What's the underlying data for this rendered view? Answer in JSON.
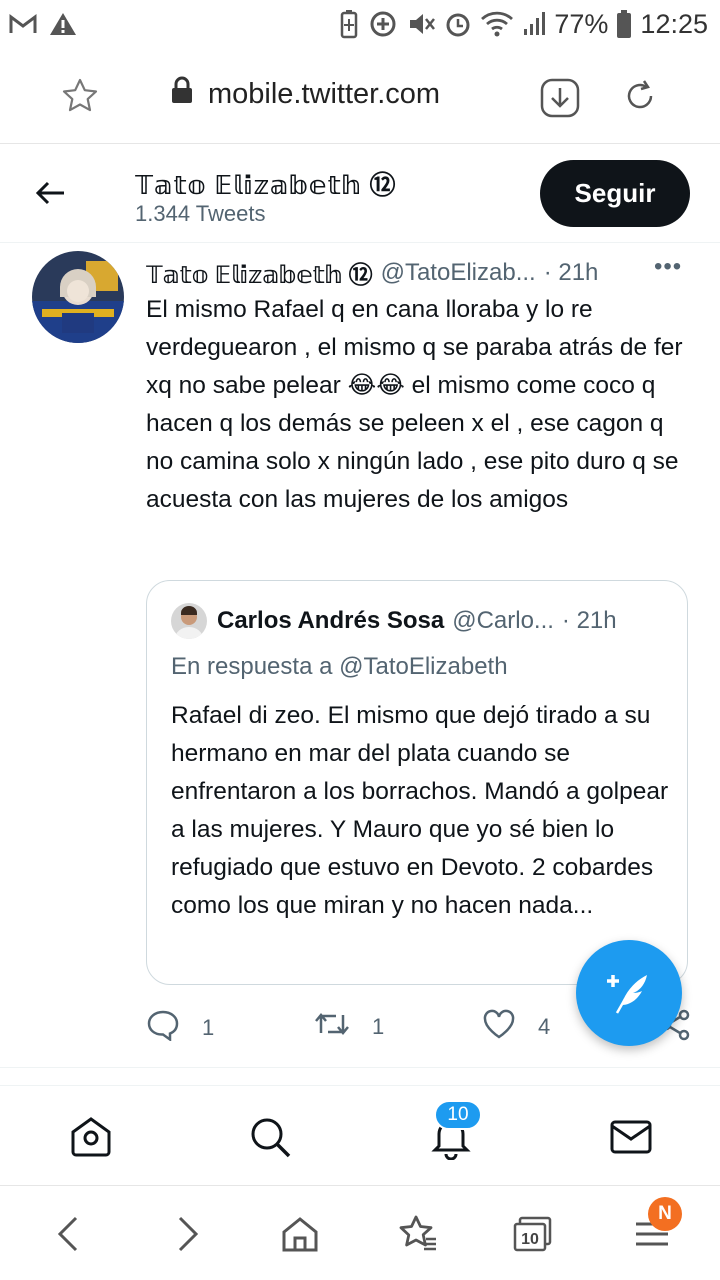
{
  "status_bar": {
    "battery": "77%",
    "time": "12:25"
  },
  "browser": {
    "url": "mobile.twitter.com",
    "tabs_count": "10",
    "menu_badge": "N"
  },
  "profile": {
    "name": "𝕋𝕒𝕥𝕠 𝔼𝕝𝕚𝕫𝕒𝕓𝕖𝕥𝕙 ⑫",
    "tweet_count": "1.344 Tweets",
    "follow_label": "Seguir"
  },
  "tweet": {
    "author_name": "𝕋𝕒𝕥𝕠 𝔼𝕝𝕚𝕫𝕒𝕓𝕖𝕥𝕙 ⑫",
    "handle": "@TatoElizab...",
    "time": "· 21h",
    "more": "•••",
    "text": "El mismo Rafael q en cana lloraba y lo re verdeguearon , el mismo q se paraba atrás de fer xq no sabe pelear 😂😂 el mismo come coco q hacen q los demás se peleen x el , ese cagon q no camina solo x ningún lado , ese pito duro q se acuesta con las mujeres de los amigos",
    "replies": "1",
    "retweets": "1",
    "likes": "4"
  },
  "quote": {
    "author_name": "Carlos Andrés Sosa",
    "handle": "@Carlo...",
    "time": "· 21h",
    "reply_prefix": "En respuesta a",
    "reply_to": "@TatoElizabeth",
    "text": "Rafael di zeo. El mismo que dejó tirado a su hermano en mar del plata cuando se enfrentaron a los borrachos. Mandó a golpear a las mujeres. Y Mauro que yo sé bien lo refugiado que estuvo en Devoto. 2 cobardes como los que miran y no hacen nada..."
  },
  "nav": {
    "notifications_badge": "10"
  },
  "colors": {
    "twitter_blue": "#1d9bf0",
    "text_primary": "#0f1419",
    "text_secondary": "#536471",
    "browser_badge": "#f36f21"
  }
}
